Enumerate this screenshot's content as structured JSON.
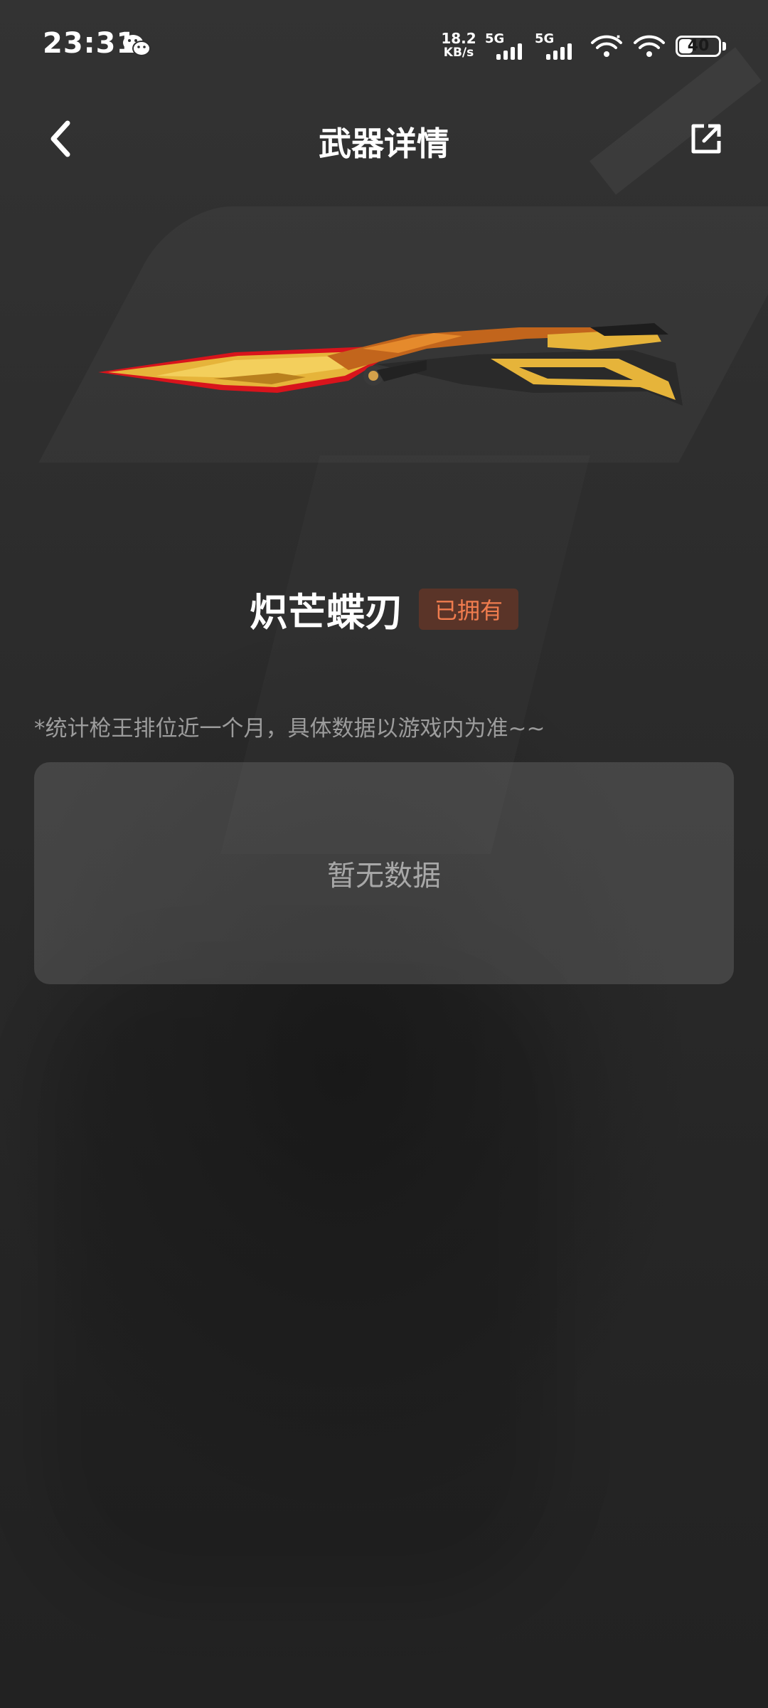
{
  "status_bar": {
    "time": "23:31",
    "net_speed_value": "18.2",
    "net_speed_unit": "KB/s",
    "sim1_label": "5G",
    "sim2_label": "5G",
    "battery_level": "40",
    "battery_percent": 40,
    "notification_icon": "wechat-icon"
  },
  "header": {
    "title": "武器详情",
    "back_icon": "chevron-left-icon",
    "share_icon": "share-external-icon"
  },
  "weapon": {
    "name": "炽芒蝶刃",
    "badge": "已拥有",
    "badge_color": "#f07c4e",
    "badge_bg": "#5a3428"
  },
  "stats": {
    "note": "*统计枪王排位近一个月，具体数据以游戏内为准~~",
    "empty_text": "暂无数据"
  }
}
